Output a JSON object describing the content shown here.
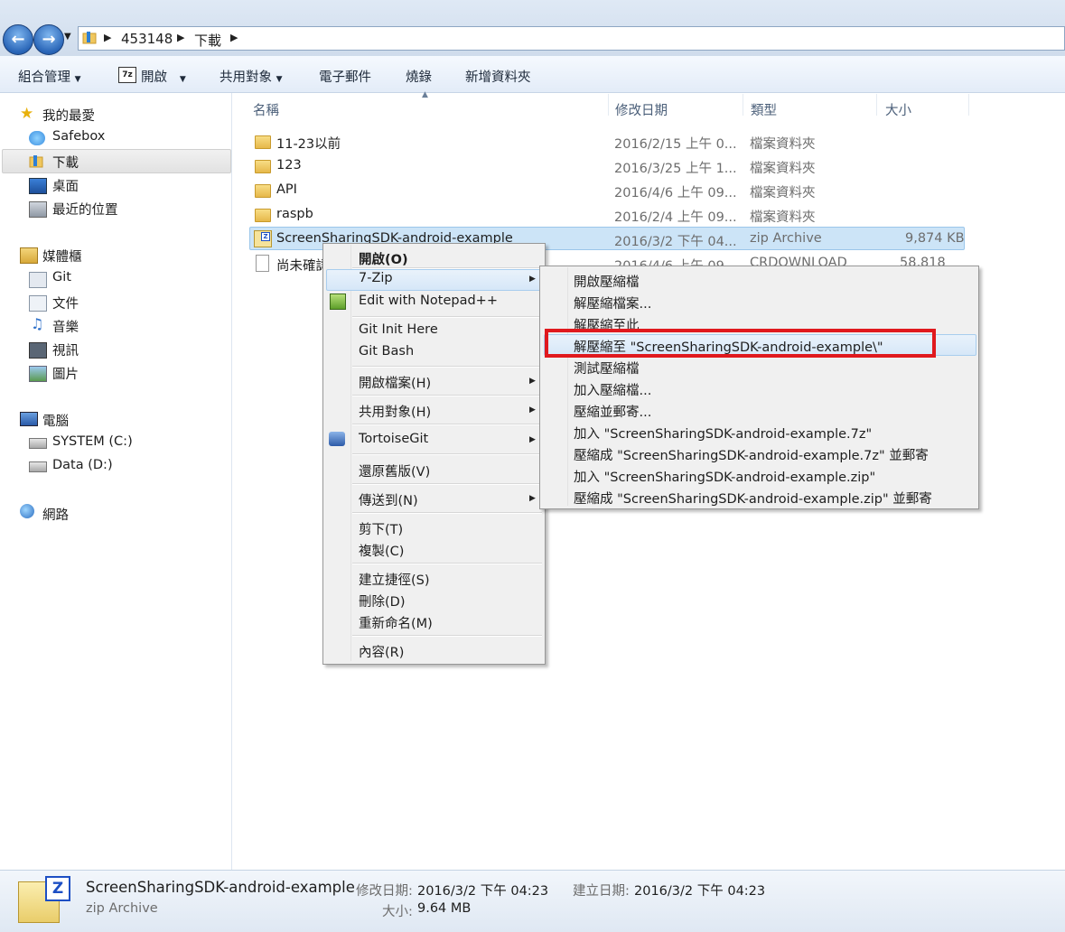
{
  "address": {
    "crumbs": [
      "453148",
      "下載"
    ]
  },
  "toolbar": {
    "organize": "組合管理",
    "open": "開啟",
    "open_icon_label": "7z",
    "share": "共用對象",
    "email": "電子郵件",
    "burn": "燒錄",
    "new_folder": "新增資料夾"
  },
  "nav": {
    "favorites": "我的最愛",
    "safebox": "Safebox",
    "downloads": "下載",
    "desktop": "桌面",
    "recent": "最近的位置",
    "libraries": "媒體櫃",
    "git": "Git",
    "documents": "文件",
    "music": "音樂",
    "videos": "視訊",
    "pictures": "圖片",
    "computer": "電腦",
    "drive_c": "SYSTEM  (C:)",
    "drive_d": "Data (D:)",
    "network": "網路"
  },
  "columns": {
    "name": "名稱",
    "modified": "修改日期",
    "type": "類型",
    "size": "大小"
  },
  "files": [
    {
      "name": "11-23以前",
      "modified": "2016/2/15 上午 0...",
      "type": "檔案資料夾",
      "size": ""
    },
    {
      "name": "123",
      "modified": "2016/3/25 上午 1...",
      "type": "檔案資料夾",
      "size": ""
    },
    {
      "name": "API",
      "modified": "2016/4/6 上午 09...",
      "type": "檔案資料夾",
      "size": ""
    },
    {
      "name": "raspb",
      "modified": "2016/2/4 上午 09...",
      "type": "檔案資料夾",
      "size": ""
    },
    {
      "name": "ScreenSharingSDK-android-example",
      "modified": "2016/3/2 下午 04...",
      "type": "zip Archive",
      "size": "9,874 KB"
    },
    {
      "name": "尚未確認",
      "modified": "2016/4/6 上午 09...",
      "type": "CRDOWNLOAD",
      "size": "58,818 KB"
    }
  ],
  "context_menu": {
    "open": "開啟(O)",
    "sevenzip": "7-Zip",
    "notepadpp": "Edit with Notepad++",
    "git_init": "Git Init Here",
    "git_bash": "Git Bash",
    "open_with": "開啟檔案(H)",
    "share_with": "共用對象(H)",
    "tortoisegit": "TortoiseGit",
    "restore": "還原舊版(V)",
    "send_to": "傳送到(N)",
    "cut": "剪下(T)",
    "copy": "複製(C)",
    "shortcut": "建立捷徑(S)",
    "delete": "刪除(D)",
    "rename": "重新命名(M)",
    "properties": "內容(R)"
  },
  "submenu_7zip": [
    "開啟壓縮檔",
    "解壓縮檔案...",
    "解壓縮至此",
    "解壓縮至 \"ScreenSharingSDK-android-example\\\"",
    "測試壓縮檔",
    "加入壓縮檔...",
    "壓縮並郵寄...",
    "加入 \"ScreenSharingSDK-android-example.7z\"",
    "壓縮成 \"ScreenSharingSDK-android-example.7z\" 並郵寄",
    "加入 \"ScreenSharingSDK-android-example.zip\"",
    "壓縮成 \"ScreenSharingSDK-android-example.zip\" 並郵寄"
  ],
  "highlight_color": "#e0191e",
  "details": {
    "name": "ScreenSharingSDK-android-example",
    "type": "zip Archive",
    "modified_label": "修改日期:",
    "modified": "2016/3/2 下午 04:23",
    "created_label": "建立日期:",
    "created": "2016/3/2 下午 04:23",
    "size_label": "大小:",
    "size": "9.64 MB",
    "icon_letter": "Z"
  }
}
